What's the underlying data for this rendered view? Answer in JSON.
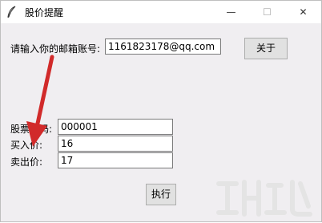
{
  "window": {
    "title": "股价提醒",
    "min_glyph": "—",
    "max_glyph": "☐",
    "close_glyph": "✕"
  },
  "email": {
    "label": "请输入你的邮箱账号:",
    "value": "1161823178@qq.com"
  },
  "about_button": "关于",
  "stock": {
    "code_label": "股票代码:",
    "code_value": "000001",
    "buy_label": "买入价:",
    "buy_value": "16",
    "sell_label": "卖出价:",
    "sell_value": "17"
  },
  "execute_button": "执行",
  "colors": {
    "annotation_arrow": "#d12a2a",
    "window_bg": "#f0eef1"
  }
}
